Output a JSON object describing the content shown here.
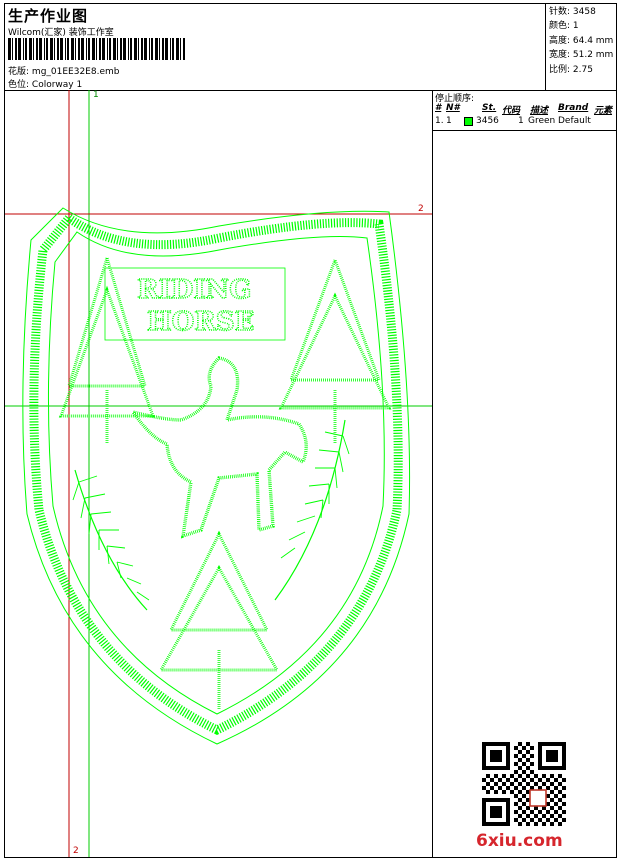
{
  "header": {
    "title": "生产作业图",
    "company": "Wilcom(汇家) 装饰工作室",
    "design_label": "花版:",
    "design_value": "mg_01EE32E8.emb",
    "colorway_label": "色位:",
    "colorway_value": "Colorway 1"
  },
  "stats": {
    "stitches": "针数: 3458",
    "colors": "颜色: 1",
    "height": "高度: 64.4 mm",
    "width": "宽度: 51.2 mm",
    "scale": "比例: 2.75"
  },
  "canvas": {
    "guide_v_red_label": "2",
    "guide_v_green_label": "1",
    "guide_h_red_label": "2",
    "design_colors": {
      "stitch": "#00ff00",
      "guide_red": "#c00000",
      "guide_green": "#00cc00"
    }
  },
  "stop_sequence": {
    "title": "停止顺序:",
    "columns": [
      "#",
      "N#",
      "St.",
      "代码",
      "描述",
      "Brand",
      "元素"
    ],
    "rows": [
      {
        "index": "1.",
        "needle": "1",
        "stitches": "3456",
        "code": "1",
        "description": "Green",
        "brand": "Default",
        "color": "#00ff00"
      }
    ]
  },
  "watermark": {
    "text": "6xiu.com"
  }
}
